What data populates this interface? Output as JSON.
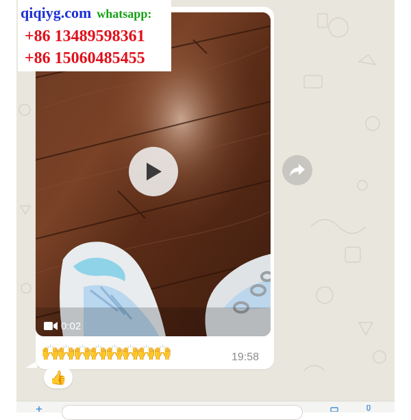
{
  "watermark": {
    "site": "qiqiyg.com",
    "label": "whatsapp:",
    "phones": [
      "+86 13489598361",
      "+86 15060485455"
    ]
  },
  "message": {
    "video_duration": "0:02",
    "reactions_text": "🙌🙌🙌🙌🙌🙌🙌🙌",
    "time": "19:58",
    "reaction_badge": "👍"
  },
  "icons": {
    "play": "play-icon",
    "video_camera": "video-camera-icon",
    "forward": "forward-arrow-icon"
  },
  "colors": {
    "chat_background": "#e9e6dd",
    "bubble": "#ffffff",
    "watermark_site": "#1d2fd6",
    "watermark_label": "#16a015",
    "watermark_phone": "#e0101a",
    "timestamp": "#8c8c8c"
  }
}
